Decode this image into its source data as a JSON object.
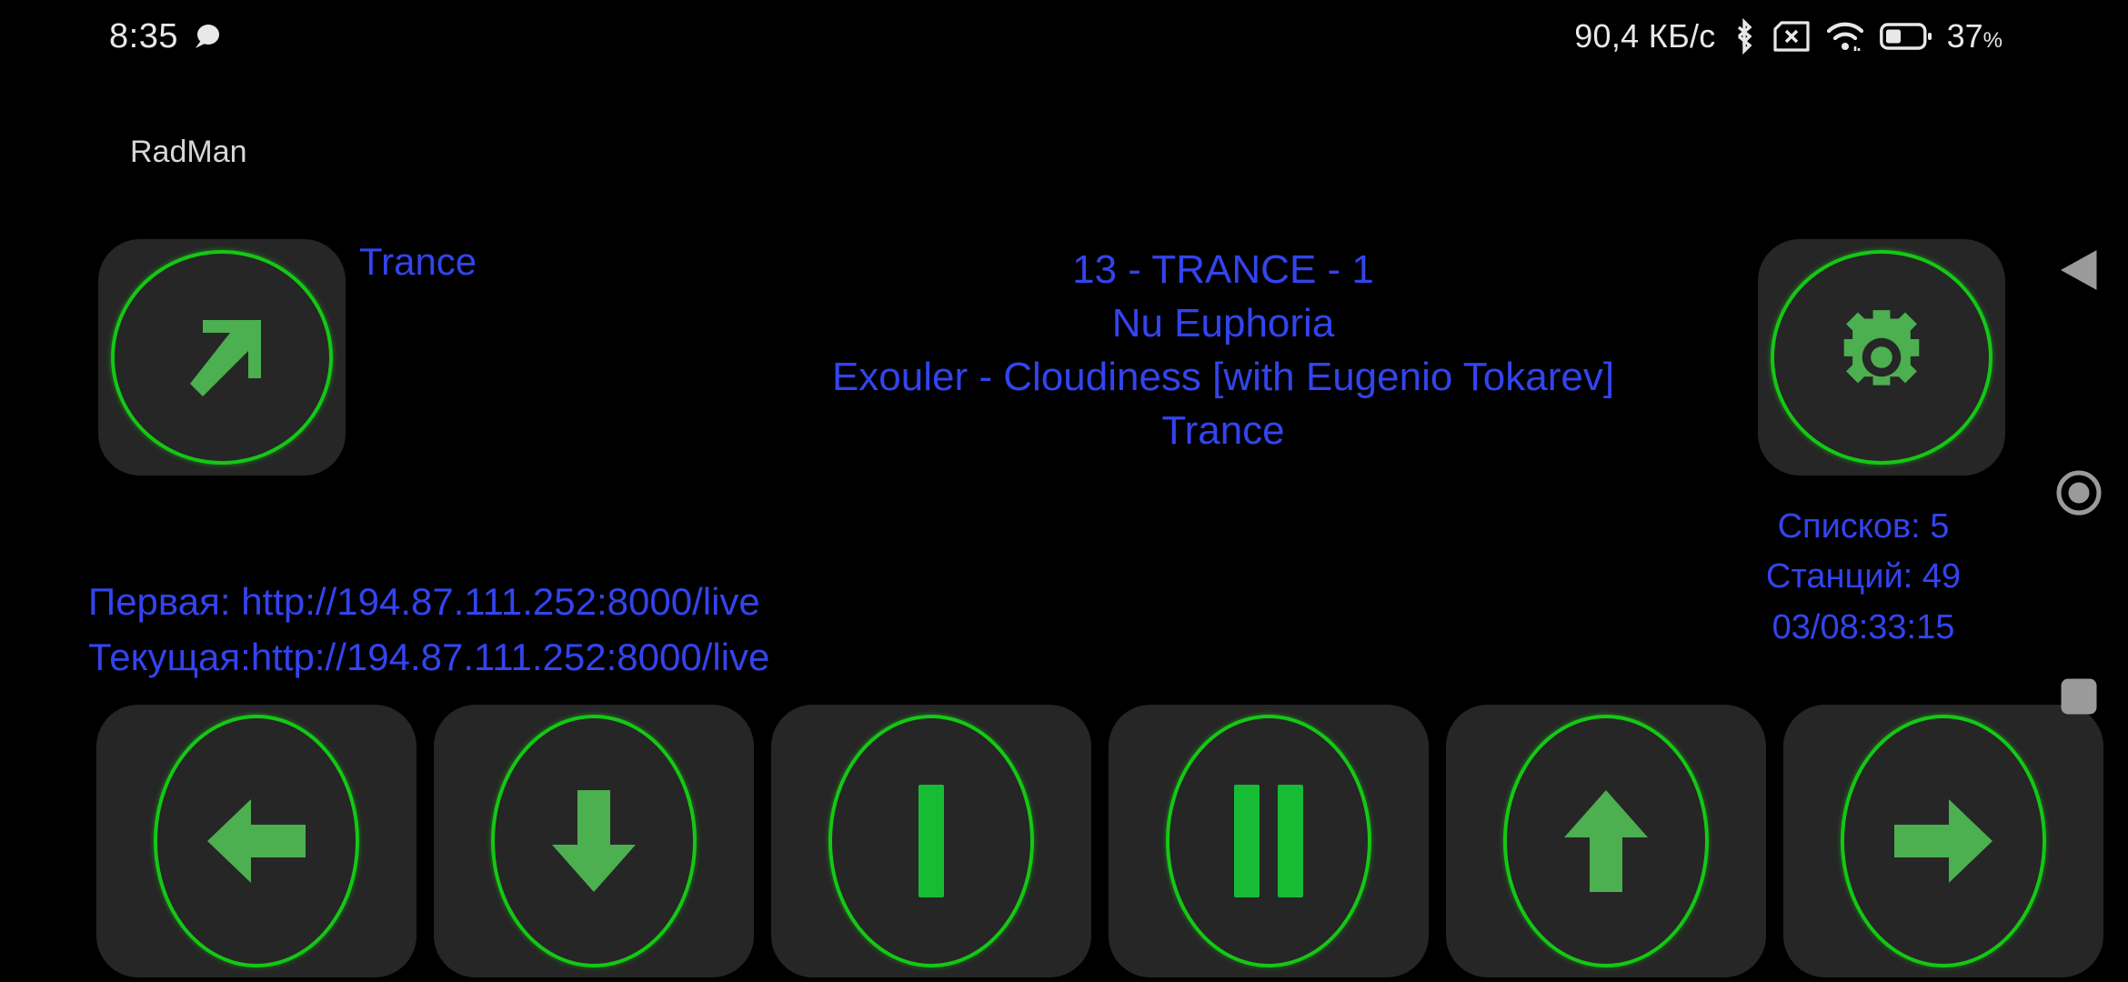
{
  "statusbar": {
    "clock": "8:35",
    "notification_icon": "speech-bubble-icon",
    "network_speed": "90,4 КБ/с",
    "bluetooth_icon": "bluetooth-icon",
    "sim_icon": "sim-card-missing-icon",
    "wifi_icon": "wifi-icon",
    "battery_icon": "battery-icon",
    "battery_percent": "37",
    "battery_percent_symbol": "%"
  },
  "app": {
    "title": "RadMan"
  },
  "genre_button": {
    "icon": "arrow-up-right-icon",
    "label": "Trance"
  },
  "settings_button": {
    "icon": "gear-icon"
  },
  "now_playing": {
    "index_line": "13  - TRANCE -  1",
    "station": "Nu Euphoria",
    "track": "Exouler - Cloudiness [with Eugenio Tokarev]",
    "genre": "Trance"
  },
  "urls": {
    "first_label": "Первая:",
    "first_value": "http://194.87.111.252:8000/live",
    "current_label": "Текущая:",
    "current_value": "http://194.87.111.252:8000/live"
  },
  "stats": {
    "lists": "Списков: 5",
    "stations": "Станций: 49",
    "timer": "03/08:33:15"
  },
  "transport": [
    {
      "name": "prev-list-button",
      "icon": "arrow-left-icon"
    },
    {
      "name": "next-station-down-button",
      "icon": "arrow-down-icon"
    },
    {
      "name": "stop-button",
      "icon": "stop-bar-icon"
    },
    {
      "name": "pause-button",
      "icon": "pause-icon"
    },
    {
      "name": "prev-station-up-button",
      "icon": "arrow-up-icon"
    },
    {
      "name": "next-list-button",
      "icon": "arrow-right-icon"
    }
  ],
  "navbar": {
    "back": "back-triangle-icon",
    "home": "home-circle-icon",
    "recents": "recents-square-icon"
  },
  "colors": {
    "background": "#000000",
    "accent_green": "#14c814",
    "glyph_green": "#4caf50",
    "text_blue": "#3344ee",
    "panel": "#262626",
    "status_text": "#e8e8e8"
  }
}
